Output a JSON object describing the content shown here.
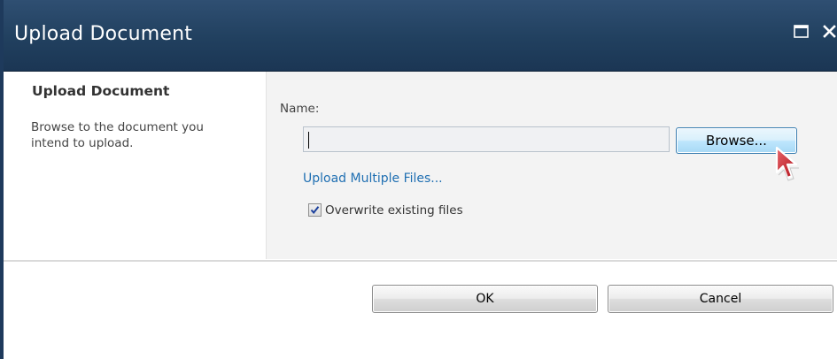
{
  "window": {
    "title": "Upload Document",
    "maximize_icon": "maximize-icon",
    "close_icon": "close-icon",
    "titlebar_color": "#21405f"
  },
  "sidebar": {
    "heading": "Upload Document",
    "description": "Browse to the document you intend to upload."
  },
  "form": {
    "name_label": "Name:",
    "name_value": "",
    "browse_label": "Browse...",
    "upload_multiple_link": "Upload Multiple Files...",
    "link_color": "#1f6fb2",
    "overwrite_label": "Overwrite existing files",
    "overwrite_checked": true
  },
  "footer": {
    "ok_label": "OK",
    "cancel_label": "Cancel"
  },
  "cursor": "pointer-cursor-icon"
}
